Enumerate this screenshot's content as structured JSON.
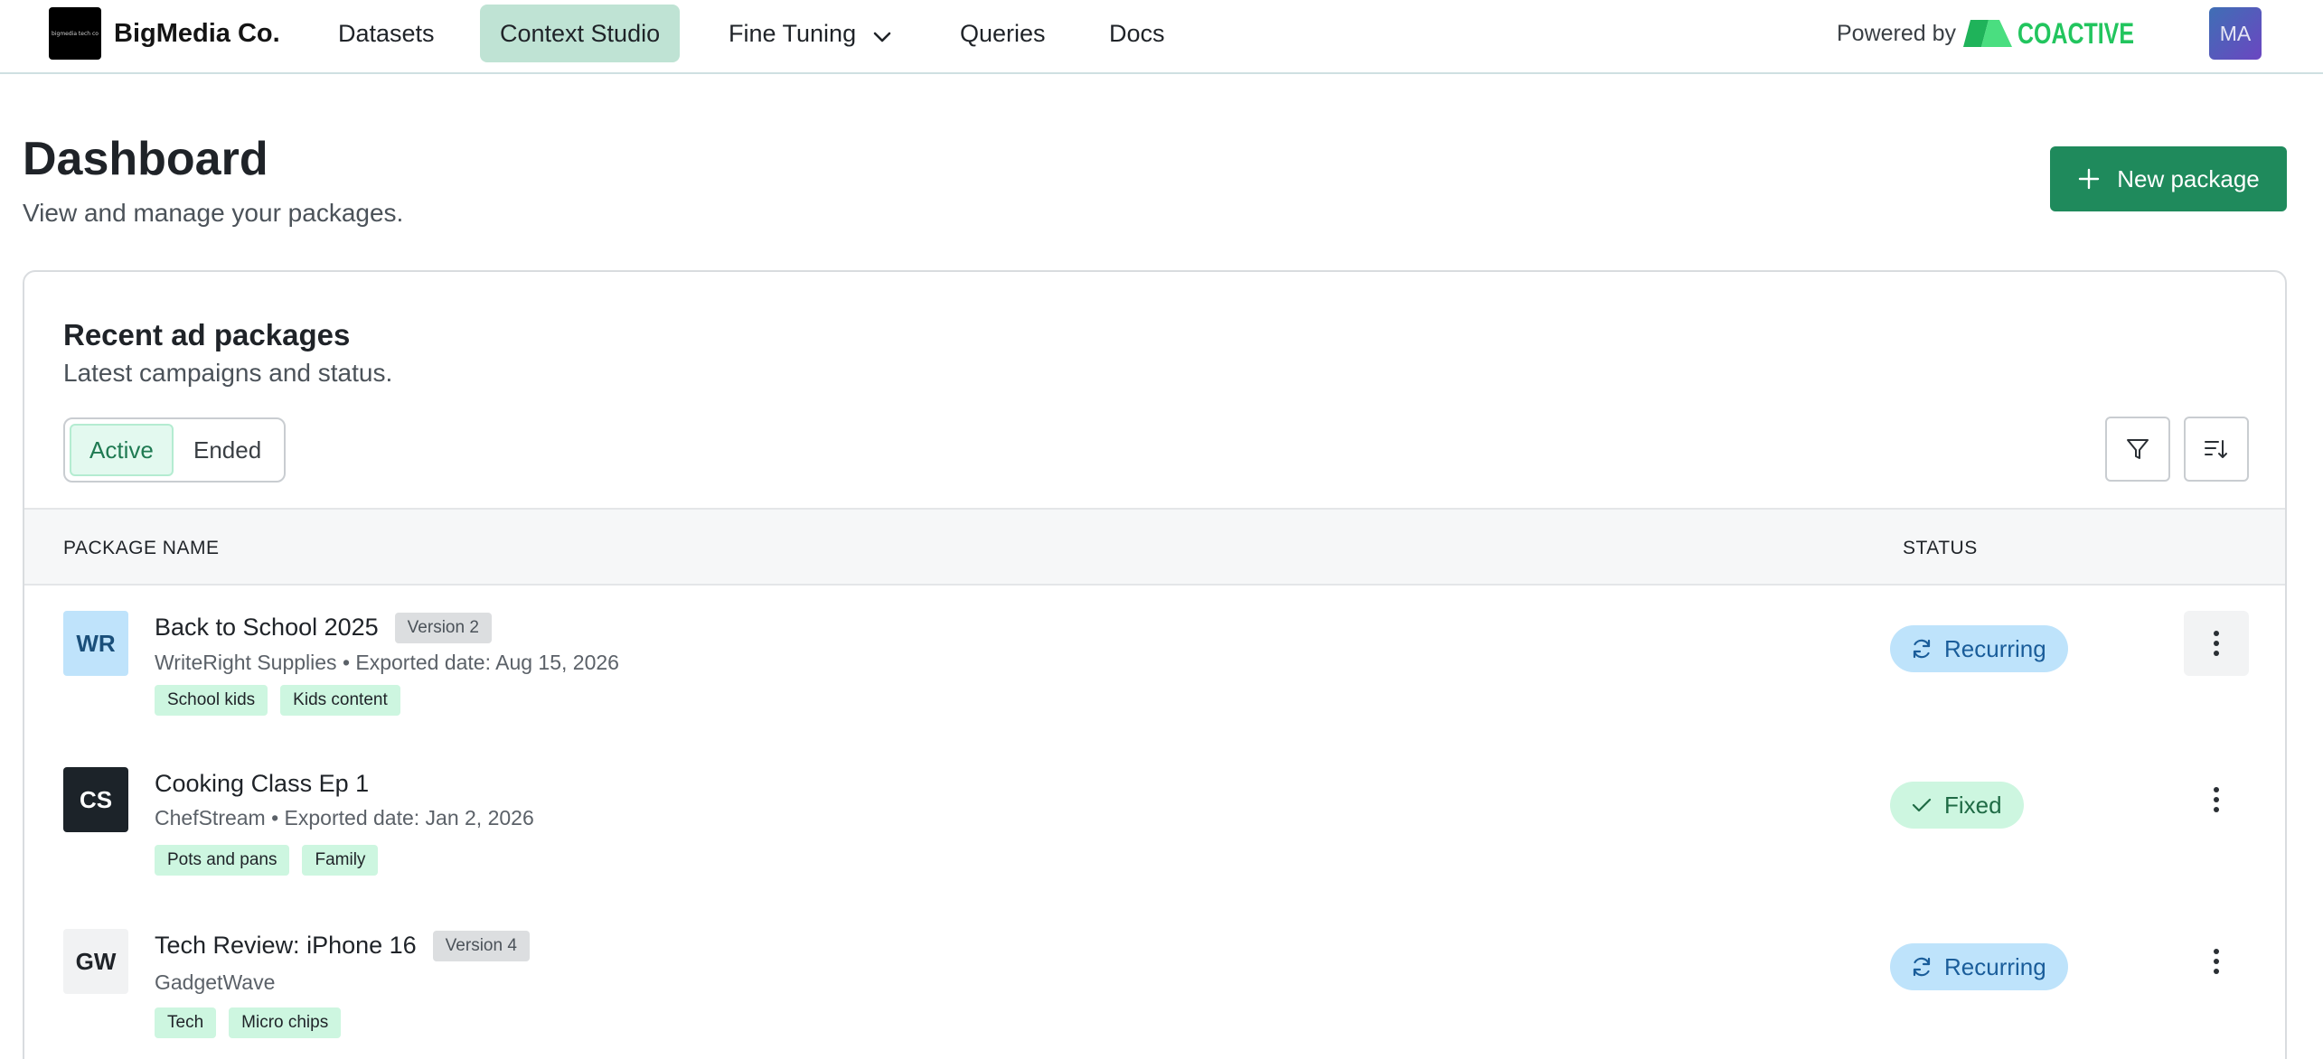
{
  "brand": {
    "logo_text": "bigmedia tech co",
    "name": "BigMedia Co."
  },
  "nav": {
    "items": [
      {
        "label": "Datasets"
      },
      {
        "label": "Context Studio",
        "active": true
      },
      {
        "label": "Fine Tuning",
        "has_dropdown": true
      },
      {
        "label": "Queries"
      },
      {
        "label": "Docs"
      }
    ],
    "powered_by": "Powered by",
    "partner": "COACTIVE",
    "avatar_initials": "MA"
  },
  "header": {
    "title": "Dashboard",
    "subtitle": "View and manage your packages.",
    "new_button": "New package"
  },
  "card": {
    "title": "Recent ad packages",
    "subtitle": "Latest campaigns and status.",
    "tabs": [
      {
        "label": "Active",
        "active": true
      },
      {
        "label": "Ended"
      }
    ],
    "columns": {
      "name": "PACKAGE NAME",
      "status": "STATUS"
    },
    "rows": [
      {
        "initials": "WR",
        "name": "Back to School 2025",
        "version": "Version 2",
        "meta": "WriteRight Supplies •  Exported date: Aug 15, 2026",
        "tags": [
          "School kids",
          "Kids content"
        ],
        "status": "Recurring",
        "avatar_bg": "#bfe3fb",
        "avatar_fg": "#1a4f7a"
      },
      {
        "initials": "CS",
        "name": "Cooking Class Ep 1",
        "version": "",
        "meta": "ChefStream • Exported date: Jan 2, 2026",
        "tags": [
          "Pots and pans",
          "Family"
        ],
        "status": "Fixed",
        "avatar_bg": "#1c2329",
        "avatar_fg": "#ffffff"
      },
      {
        "initials": "GW",
        "name": "Tech Review: iPhone 16",
        "version": "Version 4",
        "meta": "GadgetWave",
        "tags": [
          "Tech",
          "Micro chips"
        ],
        "status": "Recurring",
        "avatar_bg": "#f1f2f3",
        "avatar_fg": "#1f2328"
      }
    ]
  },
  "colors": {
    "accent": "#1f8a5c",
    "nav_active": "#bfe3d4",
    "recurring": "#bee3fb",
    "fixed": "#cdf6e0"
  }
}
